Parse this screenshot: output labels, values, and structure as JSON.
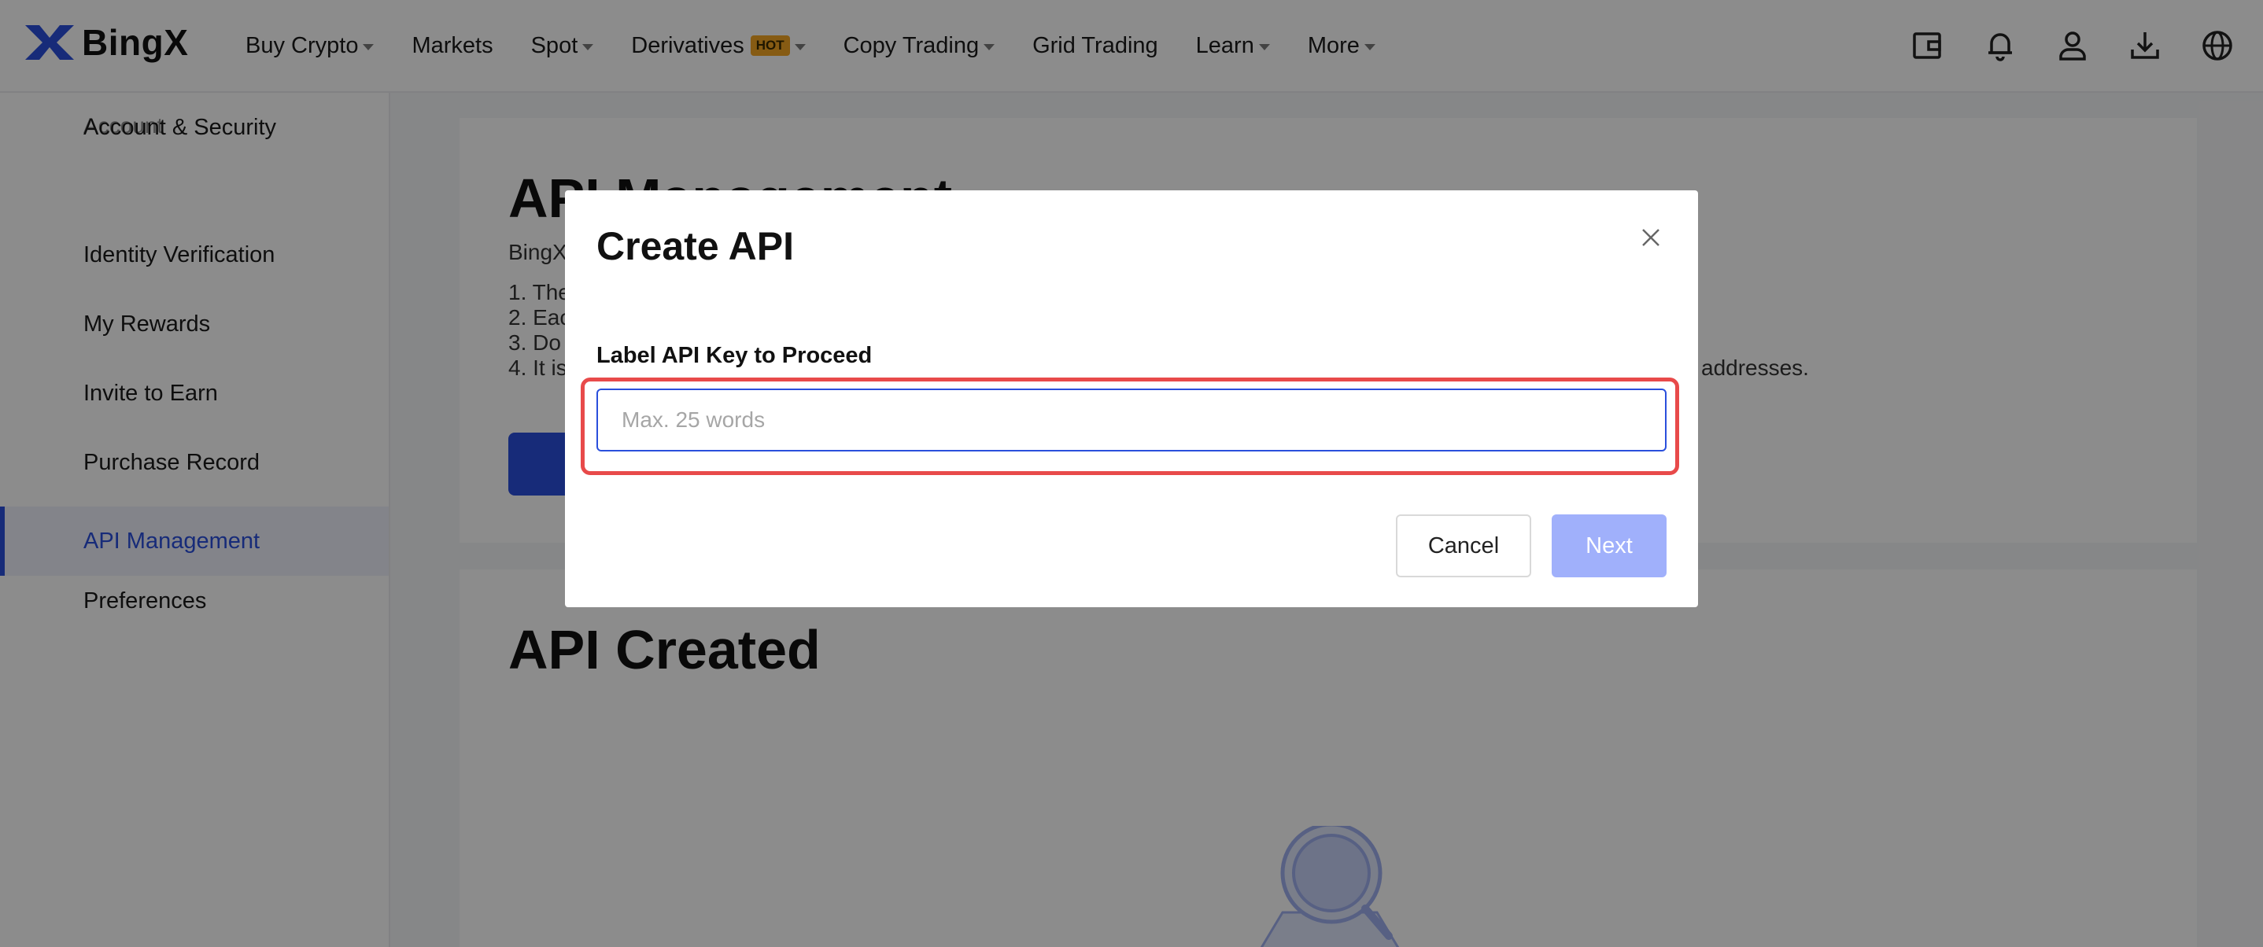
{
  "header": {
    "logo_text": "BingX",
    "nav": [
      {
        "label": "Buy Crypto",
        "dropdown": true
      },
      {
        "label": "Markets",
        "dropdown": false
      },
      {
        "label": "Spot",
        "dropdown": true
      },
      {
        "label": "Derivatives",
        "badge": "HOT",
        "dropdown": true
      },
      {
        "label": "Copy Trading",
        "dropdown": true
      },
      {
        "label": "Grid Trading",
        "dropdown": false
      },
      {
        "label": "Learn",
        "dropdown": true
      },
      {
        "label": "More",
        "dropdown": true
      }
    ],
    "icons": [
      "wallet-icon",
      "bell-icon",
      "user-icon",
      "download-icon",
      "globe-icon"
    ]
  },
  "sidebar": {
    "heading": "Account",
    "items": [
      {
        "label": "Account & Security"
      },
      {
        "label": "Identity Verification"
      },
      {
        "label": "My Rewards"
      },
      {
        "label": "Invite to Earn"
      },
      {
        "label": "Purchase Record"
      },
      {
        "label": "API Management",
        "active": true
      },
      {
        "label": "Preferences"
      }
    ]
  },
  "main": {
    "title": "API Management",
    "intro": "BingX",
    "rules": [
      "1. The",
      "2. Eac",
      "3. Do",
      "4. It is"
    ],
    "rule_tail": "addresses.",
    "created_title": "API Created"
  },
  "modal": {
    "title": "Create API",
    "field_label": "Label API Key to Proceed",
    "input_value": "",
    "input_placeholder": "Max. 25 words",
    "cancel_label": "Cancel",
    "next_label": "Next"
  },
  "colors": {
    "brand": "#2a4fdc",
    "next_disabled": "#a0b0fb",
    "highlight": "#e84a4a",
    "hot_badge": "#f5a623"
  }
}
